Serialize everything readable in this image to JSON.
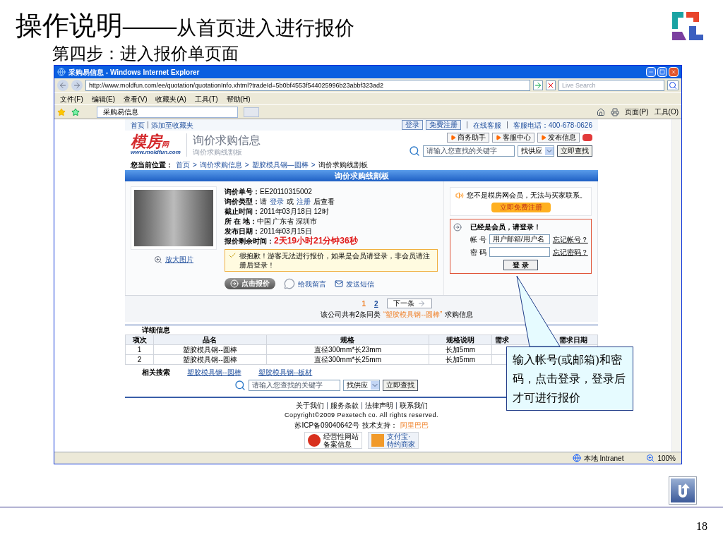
{
  "slide": {
    "title": "操作说明——",
    "subtitle": "从首页进入进行报价",
    "step": "第四步：进入报价单页面",
    "page_number": "18"
  },
  "window": {
    "title": "采购易信息 - Windows Internet Explorer",
    "address": "http://www.moldfun.com/ee/quotation/quotationInfo.xhtml?tradeId=5b0bf4553f544025996b23abbf323ad2",
    "search_placeholder": "Live Search",
    "menu": [
      "文件(F)",
      "编辑(E)",
      "查看(V)",
      "收藏夹(A)",
      "工具(T)",
      "帮助(H)"
    ],
    "tab": "采购易信息",
    "tools": [
      "页面(P)",
      "工具(O)"
    ],
    "status": "本地 Intranet",
    "zoom": "100%"
  },
  "page": {
    "top_links": [
      "首页",
      "添加至收藏夹"
    ],
    "login_button": "登录",
    "register_button": "免费注册",
    "service_links": [
      "在线客服",
      "客服电话：400-678-0626"
    ],
    "logo": {
      "mark": "模房",
      "suffix": "网",
      "url": "www.moldfun.com"
    },
    "section_title": "询价求购信息",
    "section_subtitle": "询价求购线割板",
    "header_buttons": [
      "商务助手",
      "客服中心",
      "发布信息"
    ],
    "search": {
      "placeholder": "请输入您查找的关键字",
      "scope": "找供应",
      "button": "立即查找"
    },
    "breadcrumb": {
      "label": "您当前位置：",
      "separator": ">",
      "items": [
        "首页",
        "询价求购信息",
        "塑胶模具钢—圆棒",
        "询价求购线割板"
      ]
    },
    "banner": "询价求购线割板",
    "enlarge": "放大图片",
    "details": [
      {
        "kind": "text",
        "label": "询价单号：",
        "value": "EE20110315002"
      },
      {
        "kind": "links",
        "label": "询价类型：",
        "parts": [
          {
            "text": "请",
            "link": false
          },
          {
            "text": "登录",
            "link": true
          },
          {
            "text": "或",
            "link": false
          },
          {
            "text": "注册",
            "link": true
          },
          {
            "text": "后查看",
            "link": false
          }
        ]
      },
      {
        "kind": "text",
        "label": "截止时间：",
        "value": "2011年03月18日 12时"
      },
      {
        "kind": "text",
        "label": "所 在 地：",
        "value": "中国 广东省 深圳市"
      },
      {
        "kind": "text",
        "label": "发布日期：",
        "value": "2011年03月15日"
      },
      {
        "kind": "countdown",
        "label": "报价剩余时间：",
        "value": "2天19小时21分钟36秒"
      }
    ],
    "warning": "很抱歉！游客无法进行报价，如果是会员请登录，非会员请注册后登录！",
    "actions": [
      "点击报价",
      "给我留言",
      "发送短信"
    ],
    "notice": "您不是模房网会员，无法与买家联系。",
    "register_now": "立即免费注册",
    "login": {
      "title": "已经是会员，请登录！",
      "account_label": "帐 号",
      "account_value": "用户邮箱/用户名",
      "forgot_account": "忘记帐号？",
      "password_label": "密 码",
      "forgot_password": "忘记密码？",
      "submit": "登 录"
    },
    "pages": [
      {
        "label": "1",
        "selected": true
      },
      {
        "label": "2",
        "selected": false
      }
    ],
    "next": "下一条",
    "similar": {
      "before": "该公司共有2条同类",
      "category": "“塑胶模具钢--圆棒”",
      "after": "求购信息"
    },
    "table": {
      "title": "详细信息",
      "columns": [
        "项次",
        "品名",
        "规格",
        "规格说明",
        "需求",
        "需求日期"
      ],
      "rows": [
        [
          "1",
          "塑胶模具钢--圆棒",
          "直径300mm*长23mm",
          "长加5mm"
        ],
        [
          "2",
          "塑胶模具钢--圆棒",
          "直径300mm*长25mm",
          "长加5mm"
        ]
      ]
    },
    "related": {
      "label": "相关搜索",
      "links": [
        "塑胶模具钢--圆棒",
        "塑胶模具钢--板材"
      ]
    },
    "search2": {
      "placeholder": "请输入您查找的关键字",
      "scope": "找供应",
      "button": "立即查找"
    },
    "footer": {
      "links": [
        "关于我们",
        "服务条款",
        "法律声明",
        "联系我们"
      ],
      "copyright": "Copyright©2009 Pexetech co. All rights reserved.",
      "icp": "苏ICP备09040642号",
      "support_label": "技术支持：",
      "support": "阿里巴巴",
      "badges": [
        [
          "经营性网站",
          "备案信息"
        ],
        [
          "支付宝·",
          "特约商家"
        ]
      ]
    }
  },
  "callout": "输入帐号(或邮箱)和密码，点击登录，登录后才可进行报价"
}
